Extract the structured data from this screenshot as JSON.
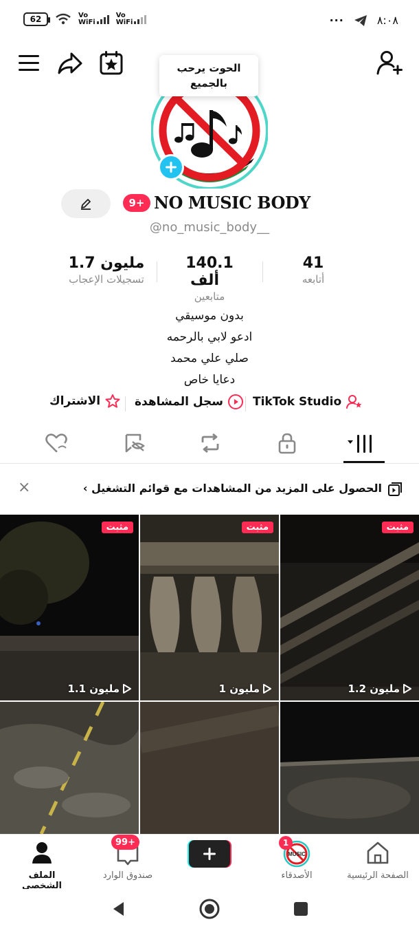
{
  "status_bar": {
    "battery": "62",
    "vowifi": "Vo\nWiFi",
    "time": "٨:٠٨",
    "dots": "···"
  },
  "tooltip": {
    "text_line1": "الحوت يرحب",
    "text_line2": "بالجميع"
  },
  "profile": {
    "name": "NO MUSIC BODY",
    "badge": "9+",
    "handle": "@no_music_body__"
  },
  "stats": {
    "likes": {
      "value": "1.7 مليون",
      "label": "تسجيلات الإعجاب"
    },
    "followers": {
      "value": "140.1",
      "unit": "ألف",
      "label": "متابعين"
    },
    "following": {
      "value": "41",
      "label": "أتابعه"
    }
  },
  "bio": [
    "بدون موسيقي",
    "ادعو لابي بالرحمه",
    "صلي علي محمد",
    "دعايا خاص"
  ],
  "links": {
    "studio": "TikTok Studio",
    "history": "سجل المشاهدة",
    "subscribe": "الاشتراك"
  },
  "promo": {
    "text": "الحصول على المزيد من المشاهدات مع قوائم التشغيل ›",
    "close": "×"
  },
  "videos": [
    {
      "pinned": "مثبت",
      "views": "1.2 مليون"
    },
    {
      "pinned": "مثبت",
      "views": "1 مليون"
    },
    {
      "pinned": "مثبت",
      "views": "1.1 مليون"
    },
    {
      "pinned": "",
      "views": ""
    },
    {
      "pinned": "",
      "views": ""
    },
    {
      "pinned": "",
      "views": ""
    }
  ],
  "nav": {
    "home": "الصفحة الرئيسية",
    "friends": "الأصدقاء",
    "friends_badge": "1",
    "inbox": "صندوق الوارد",
    "inbox_badge": "99+",
    "profile": "الملف الشخصي"
  },
  "colors": {
    "accent": "#fe2c55",
    "cyan": "#25f4ee"
  }
}
